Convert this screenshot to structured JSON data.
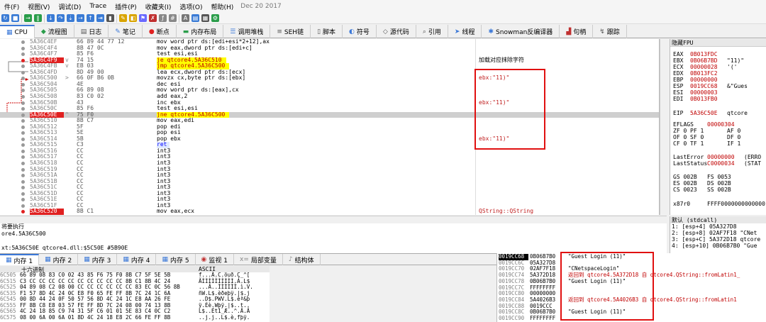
{
  "menu": [
    "件(F)",
    "视图(V)",
    "调试(D)",
    "Trace",
    "插件(P)",
    "收藏夹(I)",
    "选项(O)",
    "帮助(H)"
  ],
  "menu_date": "Dec 20 2017",
  "tabs": [
    {
      "label": "CPU",
      "icon": "cpu-icon",
      "glyph": "▦"
    },
    {
      "label": "流程图",
      "icon": "graph-icon",
      "glyph": "◆"
    },
    {
      "label": "日志",
      "icon": "log-icon",
      "glyph": "▤"
    },
    {
      "label": "笔记",
      "icon": "notes-icon",
      "glyph": "✎"
    },
    {
      "label": "断点",
      "icon": "breakpoint-icon",
      "glyph": "●"
    },
    {
      "label": "内存布局",
      "icon": "memory-map-icon",
      "glyph": "▬"
    },
    {
      "label": "调用堆栈",
      "icon": "callstack-icon",
      "glyph": "☰"
    },
    {
      "label": "SEH链",
      "icon": "seh-icon",
      "glyph": "≡"
    },
    {
      "label": "脚本",
      "icon": "script-icon",
      "glyph": "▯"
    },
    {
      "label": "符号",
      "icon": "symbols-icon",
      "glyph": "◐"
    },
    {
      "label": "源代码",
      "icon": "source-icon",
      "glyph": "◇"
    },
    {
      "label": "引用",
      "icon": "references-icon",
      "glyph": "⌕"
    },
    {
      "label": "线程",
      "icon": "threads-icon",
      "glyph": "➤"
    },
    {
      "label": "Snowman反编译器",
      "icon": "snowman-icon",
      "glyph": "✱"
    },
    {
      "label": "句柄",
      "icon": "handles-icon",
      "glyph": "▟"
    },
    {
      "label": "跟踪",
      "icon": "trace-icon",
      "glyph": "↯"
    }
  ],
  "disasm": [
    {
      "addr": "5A36C4EF",
      "arrow": "",
      "bytes": "66 89 44 77 12",
      "instr": "mov word ptr ds:[edi+esi*2+12],ax",
      "cmt": "",
      "style": ""
    },
    {
      "addr": "5A36C4F4",
      "arrow": "",
      "bytes": "8B 47 0C",
      "instr": "mov eax,dword ptr ds:[edi+c]",
      "cmt": "",
      "style": ""
    },
    {
      "addr": "5A36C4F7",
      "arrow": "",
      "bytes": "85 F6",
      "instr": "test esi,esi",
      "cmt": "",
      "style": ""
    },
    {
      "addr": "5A36C4F9",
      "arrow": "v",
      "bytes": "74 15",
      "instr": "je qtcore4.5A36C510",
      "cmt": "加载对应抹除字符",
      "style": "bpjump"
    },
    {
      "addr": "5A36C4FB",
      "arrow": "v",
      "bytes": "EB 03",
      "instr": "jmp qtcore4.5A36C500",
      "cmt": "",
      "style": "jump"
    },
    {
      "addr": "5A36C4FD",
      "arrow": "",
      "bytes": "8D 49 00",
      "instr": "lea ecx,dword ptr ds:[ecx]",
      "cmt": "",
      "style": ""
    },
    {
      "addr": "5A36C500",
      "arrow": ">",
      "bytes": "66 0F B6 0B",
      "instr": "movzx cx,byte ptr ds:[ebx]",
      "cmt": "ebx:\"11)\"",
      "style": ""
    },
    {
      "addr": "5A36C504",
      "arrow": "",
      "bytes": "4E",
      "instr": "dec esi",
      "cmt": "",
      "style": ""
    },
    {
      "addr": "5A36C505",
      "arrow": "",
      "bytes": "66 89 08",
      "instr": "mov word ptr ds:[eax],cx",
      "cmt": "",
      "style": ""
    },
    {
      "addr": "5A36C508",
      "arrow": "",
      "bytes": "83 C0 02",
      "instr": "add eax,2",
      "cmt": "",
      "style": ""
    },
    {
      "addr": "5A36C50B",
      "arrow": "",
      "bytes": "43",
      "instr": "inc ebx",
      "cmt": "ebx:\"11)\"",
      "style": ""
    },
    {
      "addr": "5A36C50C",
      "arrow": "",
      "bytes": "85 F6",
      "instr": "test esi,esi",
      "cmt": "",
      "style": ""
    },
    {
      "addr": "5A36C50E",
      "arrow": "^",
      "bytes": "75 F0",
      "instr": "jne qtcore4.5A36C500",
      "cmt": "",
      "style": "cur"
    },
    {
      "addr": "5A36C510",
      "arrow": "",
      "bytes": "8B C7",
      "instr": "mov eax,edi",
      "cmt": "",
      "style": ""
    },
    {
      "addr": "5A36C512",
      "arrow": "",
      "bytes": "5F",
      "instr": "pop edi",
      "cmt": "",
      "style": ""
    },
    {
      "addr": "5A36C513",
      "arrow": "",
      "bytes": "5E",
      "instr": "pop esi",
      "cmt": "",
      "style": ""
    },
    {
      "addr": "5A36C514",
      "arrow": "",
      "bytes": "5B",
      "instr": "pop ebx",
      "cmt": "ebx:\"11)\"",
      "style": ""
    },
    {
      "addr": "5A36C515",
      "arrow": "",
      "bytes": "C3",
      "instr": "ret",
      "cmt": "",
      "style": "ret"
    },
    {
      "addr": "5A36C516",
      "arrow": "",
      "bytes": "CC",
      "instr": "int3",
      "cmt": "",
      "style": ""
    },
    {
      "addr": "5A36C517",
      "arrow": "",
      "bytes": "CC",
      "instr": "int3",
      "cmt": "",
      "style": ""
    },
    {
      "addr": "5A36C518",
      "arrow": "",
      "bytes": "CC",
      "instr": "int3",
      "cmt": "",
      "style": ""
    },
    {
      "addr": "5A36C519",
      "arrow": "",
      "bytes": "CC",
      "instr": "int3",
      "cmt": "",
      "style": ""
    },
    {
      "addr": "5A36C51A",
      "arrow": "",
      "bytes": "CC",
      "instr": "int3",
      "cmt": "",
      "style": ""
    },
    {
      "addr": "5A36C51B",
      "arrow": "",
      "bytes": "CC",
      "instr": "int3",
      "cmt": "",
      "style": ""
    },
    {
      "addr": "5A36C51C",
      "arrow": "",
      "bytes": "CC",
      "instr": "int3",
      "cmt": "",
      "style": ""
    },
    {
      "addr": "5A36C51D",
      "arrow": "",
      "bytes": "CC",
      "instr": "int3",
      "cmt": "",
      "style": ""
    },
    {
      "addr": "5A36C51E",
      "arrow": "",
      "bytes": "CC",
      "instr": "int3",
      "cmt": "",
      "style": ""
    },
    {
      "addr": "5A36C51F",
      "arrow": "",
      "bytes": "CC",
      "instr": "int3",
      "cmt": "",
      "style": ""
    },
    {
      "addr": "5A36C520",
      "arrow": "",
      "bytes": "8B C1",
      "instr": "mov eax,ecx",
      "cmt": "QString::QString",
      "style": "bp"
    }
  ],
  "registers_header": "隐藏FPU",
  "registers": [
    {
      "n": "EAX",
      "v": "0B013FDC",
      "s": ""
    },
    {
      "n": "EBX",
      "v": "0B06B7BD",
      "s": "\"11)\""
    },
    {
      "n": "ECX",
      "v": "00000028",
      "s": "'('"
    },
    {
      "n": "EDX",
      "v": "0B013FC2",
      "s": ""
    },
    {
      "n": "EBP",
      "v": "00000000",
      "s": ""
    },
    {
      "n": "ESP",
      "v": "0019CC68",
      "s": "&\"Gues"
    },
    {
      "n": "ESI",
      "v": "00000003",
      "s": ""
    },
    {
      "n": "EDI",
      "v": "0B013FB0",
      "s": ""
    },
    {
      "n": "EIP",
      "v": "5A36C50E",
      "s": "qtcore"
    },
    {
      "n": "EFLAGS",
      "v": "00000304",
      "s": ""
    },
    {
      "n": "ZF 0",
      "v": "PF 1",
      "s": "AF 0"
    },
    {
      "n": "OF 0",
      "v": "SF 0",
      "s": "DF 0"
    },
    {
      "n": "CF 0",
      "v": "TF 1",
      "s": "IF 1"
    },
    {
      "n": "LastError",
      "v": "00000000",
      "s": "(ERRO"
    },
    {
      "n": "LastStatus",
      "v": "C0000034",
      "s": "(STAT"
    },
    {
      "n": "GS 002B",
      "v": "FS 0053",
      "s": ""
    },
    {
      "n": "ES 002B",
      "v": "DS 002B",
      "s": ""
    },
    {
      "n": "CS 0023",
      "v": "SS 002B",
      "s": ""
    },
    {
      "n": "x87r0",
      "v": "FFFF0000000000000",
      "s": ""
    }
  ],
  "info": [
    "将要执行",
    "ore4.5A36C500",
    "",
    "xt:5A36C50E qtcore4.dll:$5C50E #5B90E"
  ],
  "callstack_header": "默认 (stdcall)",
  "callstack": [
    "1: [esp+4] 05A327D8",
    "2: [esp+8] 02AF7F18 \"CNet",
    "3: [esp+C] 5A372D18 qtcore",
    "4: [esp+10] 0B06B7B0 \"Gue"
  ],
  "bottom_tabs": [
    {
      "label": "内存 1",
      "icon": "memory-icon",
      "glyph": "▦"
    },
    {
      "label": "内存 2",
      "icon": "memory-icon",
      "glyph": "▦"
    },
    {
      "label": "内存 3",
      "icon": "memory-icon",
      "glyph": "▦"
    },
    {
      "label": "内存 4",
      "icon": "memory-icon",
      "glyph": "▦"
    },
    {
      "label": "内存 5",
      "icon": "memory-icon",
      "glyph": "▦"
    },
    {
      "label": "监视 1",
      "icon": "watch-icon",
      "glyph": "◉"
    },
    {
      "label": "局部变量",
      "icon": "locals-icon",
      "glyph": "x="
    },
    {
      "label": "结构体",
      "icon": "struct-icon",
      "glyph": "♪"
    }
  ],
  "dump_header": {
    "hex": "十六进制",
    "ascii": "ASCII"
  },
  "dump": [
    {
      "a": "6C505",
      "hex": "66 89 08 83 C0 02 43 85 F6 75 F0 8B C7 5F 5E 5B",
      "asc": "f...À.C.öuð.Ç_^["
    },
    {
      "a": "6C515",
      "hex": "C3 CC CC CC CC CC CC CC CC CC CC 8B C1 8B 4C 24",
      "asc": "ÃÌÌÌÌÌÌÌÌÌÌ.Á.L$"
    },
    {
      "a": "6C525",
      "hex": "04 89 08 C2 08 00 CC CC CC CC CC CC 83 EC 0C 56 8B",
      "asc": "...Â..ÌÌÌÌÌÌ.ì.V."
    },
    {
      "a": "6C535",
      "hex": "F1 57 8D 4C 24 0C E8 F0 65 FE FF 8B 7C 24 1C 6A",
      "asc": "ñW.L$.èðeþÿ.|$.j"
    },
    {
      "a": "6C545",
      "hex": "00 8D 44 24 0F 50 57 56 8D 4C 24 1C E8 AA 26 FE",
      "asc": "..D$.PWV.L$.èª&þ"
    },
    {
      "a": "6C555",
      "hex": "FF 8B C8 E8 03 57 FE FF 8D 7C 24 08 00 74 13 8B",
      "asc": "ÿ.Èè.Wþÿ.|$..t.."
    },
    {
      "a": "6C565",
      "hex": "4C 24 18 85 C9 74 31 5F C6 01 01 5E 83 C4 0C C2",
      "asc": "L$..Ét1_Æ..^.Ä.Â"
    },
    {
      "a": "6C575",
      "hex": "08 00 6A 00 6A 01 8D 4C 24 18 E8 2C 66 FE FF 8B",
      "asc": "..j.j..L$.è,fþÿ."
    }
  ],
  "stack": [
    {
      "a": "0019CC68",
      "v": "0B06B7B0",
      "c": "\"Guest Login (11)\"",
      "red": false,
      "sel": true
    },
    {
      "a": "0019CC6C",
      "v": "05A327D8",
      "c": "",
      "red": false,
      "sel": false
    },
    {
      "a": "0019CC70",
      "v": "02AF7F18",
      "c": "\"CNetspaceLogin\"",
      "red": false,
      "sel": false
    },
    {
      "a": "0019CC74",
      "v": "5A372D18",
      "c": "返回到 qtcore4.5A372D18 自 qtcore4.QString::fromLatin1_",
      "red": true,
      "sel": false
    },
    {
      "a": "0019CC78",
      "v": "0B06B7B0",
      "c": "\"Guest Login (11)\"",
      "red": false,
      "sel": false
    },
    {
      "a": "0019CC7C",
      "v": "FFFFFFFF",
      "c": "",
      "red": false,
      "sel": false
    },
    {
      "a": "0019CC80",
      "v": "00000000",
      "c": "",
      "red": false,
      "sel": false
    },
    {
      "a": "0019CC84",
      "v": "5A4026B3",
      "c": "返回到 qtcore4.5A4026B3 自 qtcore4.QString::fromLatin1",
      "red": true,
      "sel": false
    },
    {
      "a": "0019CC88",
      "v": "0019CCC",
      "c": "",
      "red": false,
      "sel": false
    },
    {
      "a": "0019CC8C",
      "v": "0B06B7B0",
      "c": "\"Guest Login (11)\"",
      "red": false,
      "sel": false
    },
    {
      "a": "0019CC90",
      "v": "FFFFFFFF",
      "c": "",
      "red": false,
      "sel": false
    }
  ],
  "colors": {
    "accent": "#3b78d8",
    "breakpoint": "#e02020",
    "highlight": "#ffff00",
    "annotation_box": "#e01010"
  }
}
